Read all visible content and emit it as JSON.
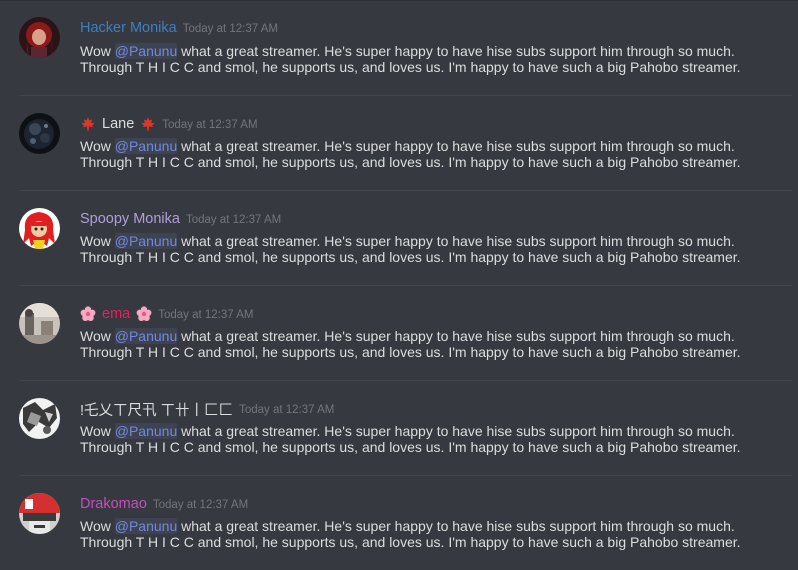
{
  "colors": {
    "background": "#36393f",
    "text": "#dcddde",
    "timestamp": "#72767d",
    "mention": "#7289da",
    "divider": "#42454a"
  },
  "messages": [
    {
      "author": "Hacker Monika",
      "author_color": "#3c7fc4",
      "flair": "",
      "timestamp": "Today at 12:37 AM",
      "avatar_icon": "red-haired-character-avatar-icon",
      "mention": "@Panunu",
      "text_before": "Wow ",
      "text_after": " what a great streamer.  He's super happy to have hise subs support him through so much.",
      "line2": "Through T H I C C and smol, he supports us, and loves us.  I'm happy to have such a big Pahobo streamer."
    },
    {
      "author": "Lane",
      "author_color": "#dcddde",
      "flair": "maple-leaf-icon",
      "timestamp": "Today at 12:37 AM",
      "avatar_icon": "dark-orb-avatar-icon",
      "mention": "@Panunu",
      "text_before": "Wow ",
      "text_after": " what a great streamer.  He's super happy to have hise subs support him through so much.",
      "line2": "Through T H I C C and smol, he supports us, and loves us.  I'm happy to have such a big Pahobo streamer."
    },
    {
      "author": "Spoopy Monika",
      "author_color": "#b39ddb",
      "flair": "",
      "timestamp": "Today at 12:37 AM",
      "avatar_icon": "red-anime-character-avatar-icon",
      "mention": "@Panunu",
      "text_before": "Wow ",
      "text_after": " what a great streamer.  He's super happy to have hise subs support him through so much.",
      "line2": "Through T H I C C and smol, he supports us, and loves us.  I'm happy to have such a big Pahobo streamer."
    },
    {
      "author": "ema",
      "author_color": "#e91e63",
      "flair": "cherry-blossom-icon",
      "timestamp": "Today at 12:37 AM",
      "avatar_icon": "grey-photo-avatar-icon",
      "mention": "@Panunu",
      "text_before": "Wow ",
      "text_after": " what a great streamer.  He's super happy to have hise subs support him through so much.",
      "line2": "Through T H I C C and smol, he supports us, and loves us.  I'm happy to have such a big Pahobo streamer."
    },
    {
      "author": "!乇乂ㄒ尺卂 ㄒ卄丨匚匚",
      "author_color": "#dcddde",
      "flair": "",
      "timestamp": "Today at 12:37 AM",
      "avatar_icon": "monochrome-sketch-avatar-icon",
      "mention": "@Panunu",
      "text_before": "Wow ",
      "text_after": " what a great streamer.  He's super happy to have hise subs support him through so much.",
      "line2": "Through T H I C C and smol, he supports us, and loves us.  I'm happy to have such a big Pahobo streamer."
    },
    {
      "author": "Drakomao",
      "author_color": "#c44fbf",
      "flair": "",
      "timestamp": "Today at 12:37 AM",
      "avatar_icon": "red-white-robot-avatar-icon",
      "mention": "@Panunu",
      "text_before": "Wow ",
      "text_after": " what a great streamer.  He's super happy to have hise subs support him through so much.",
      "line2": "Through T H I C C and smol, he supports us, and loves us.  I'm happy to have such a big Pahobo streamer."
    }
  ]
}
